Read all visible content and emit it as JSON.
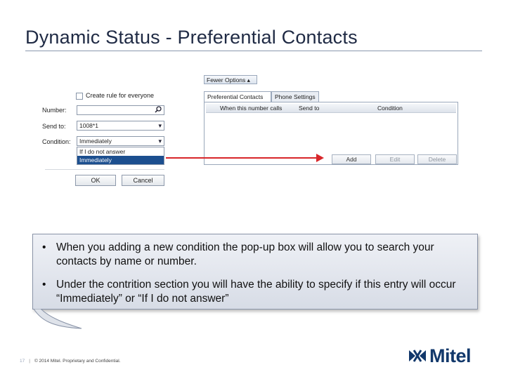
{
  "slide": {
    "title": "Dynamic Status - Preferential Contacts"
  },
  "dialog": {
    "fewer_options_label": "Fewer Options ▴",
    "create_rule_label": "Create rule for everyone",
    "number_label": "Number:",
    "number_value": "",
    "send_to_label": "Send to:",
    "send_to_value": "1008*1",
    "condition_label": "Condition:",
    "condition_value": "Immediately",
    "condition_options": [
      "If I do not answer",
      "Immediately"
    ],
    "ok_label": "OK",
    "cancel_label": "Cancel",
    "tabs": [
      "Preferential Contacts",
      "Phone Settings"
    ],
    "columns": [
      "When this number calls",
      "Send to",
      "Condition"
    ],
    "buttons": {
      "add": "Add",
      "edit": "Edit",
      "delete": "Delete"
    },
    "icons": {
      "search": "search-icon",
      "dropdown": "chevron-down-icon"
    }
  },
  "callout": {
    "bullets": [
      "When you adding  a new condition the pop-up box will allow you to search your contacts by name or number.",
      "Under the contrition section you will have the ability to specify if this entry will occur “Immediately” or “If I do not answer”"
    ]
  },
  "footer": {
    "page_number": "17",
    "copyright": "© 2014 Mitel. Proprietary and Confidential."
  },
  "logo": {
    "text": "Mitel"
  },
  "colors": {
    "title": "#1f2a44",
    "arrow": "#d8262a",
    "selection": "#1c4f8f",
    "logo": "#12386b"
  }
}
